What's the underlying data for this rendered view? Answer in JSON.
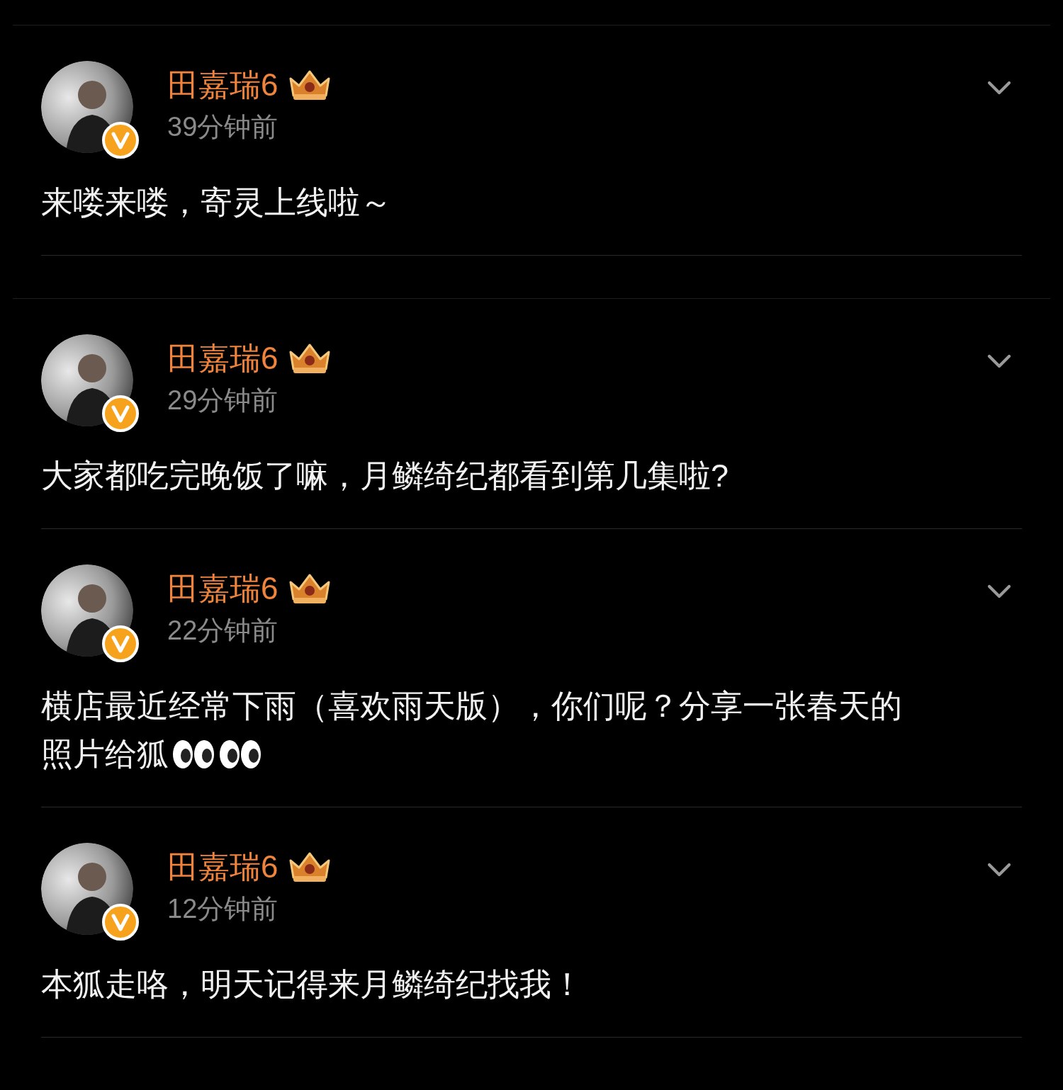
{
  "posts": [
    {
      "author": "田嘉瑞6",
      "verified": true,
      "time": "39分钟前",
      "lines": [
        "来喽来喽，寄灵上线啦～"
      ]
    },
    {
      "author": "田嘉瑞6",
      "verified": true,
      "time": "29分钟前",
      "lines": [
        "大家都吃完晚饭了嘛，月鳞绮纪都看到第几集啦?"
      ]
    },
    {
      "author": "田嘉瑞6",
      "verified": true,
      "time": "22分钟前",
      "lines": [
        "横店最近经常下雨（喜欢雨天版），你们呢？分享一张春天的",
        "照片给狐"
      ],
      "emoji": [
        {
          "kind": "eyes"
        },
        {
          "kind": "eyes"
        }
      ]
    },
    {
      "author": "田嘉瑞6",
      "verified": true,
      "time": "12分钟前",
      "lines": [
        "本狐走咯，明天记得来月鳞绮纪找我！"
      ]
    }
  ]
}
